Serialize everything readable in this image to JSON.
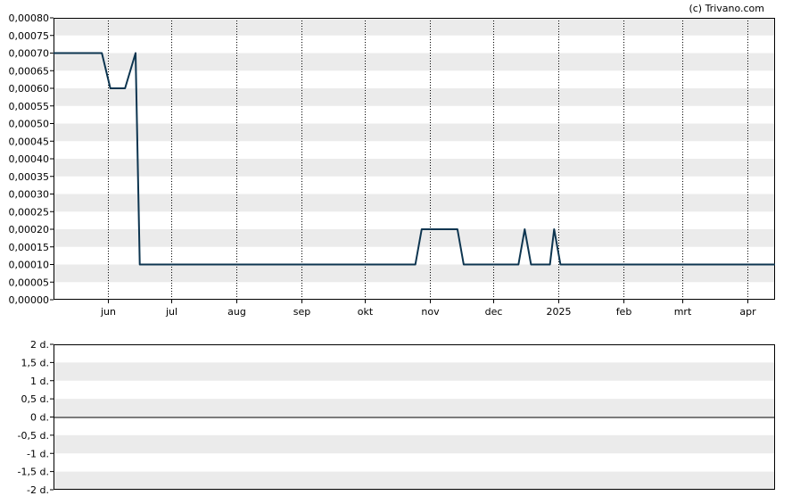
{
  "copyright": "(c) Trivano.com",
  "chart_data": [
    {
      "type": "line",
      "title": "",
      "xlabel": "",
      "ylabel": "",
      "ylim": [
        0,
        0.0008
      ],
      "grid": true,
      "colors": {
        "line": "#0d3550",
        "band": "#ebebeb",
        "vgrid": "#000000"
      },
      "y_ticks": [
        {
          "v": 0.0008,
          "label": "0,00080"
        },
        {
          "v": 0.00075,
          "label": "0,00075"
        },
        {
          "v": 0.0007,
          "label": "0,00070"
        },
        {
          "v": 0.00065,
          "label": "0,00065"
        },
        {
          "v": 0.0006,
          "label": "0,00060"
        },
        {
          "v": 0.00055,
          "label": "0,00055"
        },
        {
          "v": 0.0005,
          "label": "0,00050"
        },
        {
          "v": 0.00045,
          "label": "0,00045"
        },
        {
          "v": 0.0004,
          "label": "0,00040"
        },
        {
          "v": 0.00035,
          "label": "0,00035"
        },
        {
          "v": 0.0003,
          "label": "0,00030"
        },
        {
          "v": 0.00025,
          "label": "0,00025"
        },
        {
          "v": 0.0002,
          "label": "0,00020"
        },
        {
          "v": 0.00015,
          "label": "0,00015"
        },
        {
          "v": 0.0001,
          "label": "0,00010"
        },
        {
          "v": 5e-05,
          "label": "0,00005"
        },
        {
          "v": 0.0,
          "label": "0,00000"
        }
      ],
      "x_range": [
        "2024-05-06",
        "2025-04-14"
      ],
      "x_ticks": [
        {
          "date": "2024-06-01",
          "label": "jun"
        },
        {
          "date": "2024-07-01",
          "label": "jul"
        },
        {
          "date": "2024-08-01",
          "label": "aug"
        },
        {
          "date": "2024-09-01",
          "label": "sep"
        },
        {
          "date": "2024-10-01",
          "label": "okt"
        },
        {
          "date": "2024-11-01",
          "label": "nov"
        },
        {
          "date": "2024-12-01",
          "label": "dec"
        },
        {
          "date": "2025-01-01",
          "label": "2025"
        },
        {
          "date": "2025-02-01",
          "label": "feb"
        },
        {
          "date": "2025-03-01",
          "label": "mrt"
        },
        {
          "date": "2025-04-01",
          "label": "apr"
        }
      ],
      "series": [
        {
          "points": [
            [
              "2024-05-06",
              0.0007
            ],
            [
              "2024-05-29",
              0.0007
            ],
            [
              "2024-06-02",
              0.0006
            ],
            [
              "2024-06-09",
              0.0006
            ],
            [
              "2024-06-14",
              0.0007
            ],
            [
              "2024-06-16",
              0.0001
            ],
            [
              "2024-10-25",
              0.0001
            ],
            [
              "2024-10-28",
              0.0002
            ],
            [
              "2024-11-14",
              0.0002
            ],
            [
              "2024-11-17",
              0.0001
            ],
            [
              "2024-12-13",
              0.0001
            ],
            [
              "2024-12-16",
              0.0002
            ],
            [
              "2024-12-19",
              0.0001
            ],
            [
              "2024-12-28",
              0.0001
            ],
            [
              "2024-12-30",
              0.0002
            ],
            [
              "2025-01-02",
              0.0001
            ],
            [
              "2025-04-14",
              0.0001
            ]
          ]
        }
      ]
    },
    {
      "type": "bar",
      "title": "",
      "ylim": [
        -2,
        2
      ],
      "grid": true,
      "y_ticks": [
        {
          "v": 2,
          "label": "2 d."
        },
        {
          "v": 1.5,
          "label": "1,5 d."
        },
        {
          "v": 1,
          "label": "1 d."
        },
        {
          "v": 0.5,
          "label": "0,5 d."
        },
        {
          "v": 0,
          "label": "0 d."
        },
        {
          "v": -0.5,
          "label": "-0,5 d."
        },
        {
          "v": -1,
          "label": "-1 d."
        },
        {
          "v": -1.5,
          "label": "-1,5 d."
        },
        {
          "v": -2,
          "label": "-2 d."
        }
      ],
      "values": []
    }
  ]
}
